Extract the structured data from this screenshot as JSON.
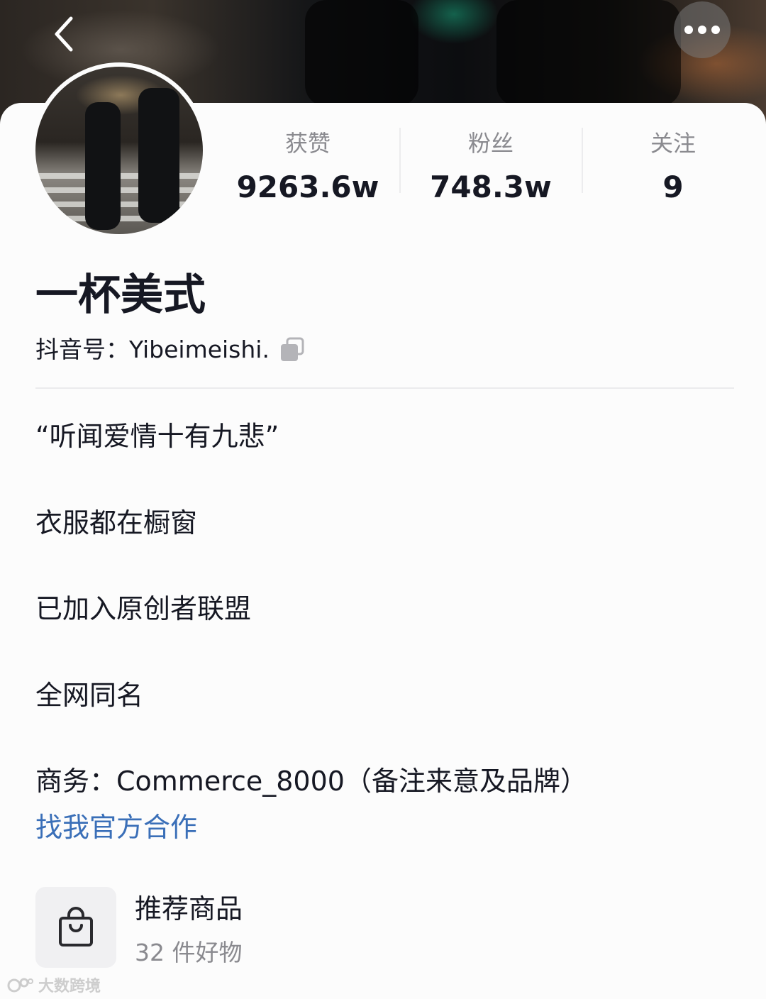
{
  "header": {
    "back_icon": "chevron-left-icon",
    "more_icon": "more-dots-icon"
  },
  "stats": [
    {
      "label": "获赞",
      "value": "9263.6w"
    },
    {
      "label": "粉丝",
      "value": "748.3w"
    },
    {
      "label": "关注",
      "value": "9"
    }
  ],
  "profile": {
    "name": "一杯美式",
    "douyin_id": "抖音号：Yibeimeishi.",
    "copy_icon": "copy-icon"
  },
  "bio": [
    "“听闻爱情十有九悲”",
    "衣服都在橱窗",
    "已加入原创者联盟",
    "全网同名",
    "商务：Commerce_8000（备注来意及品牌）"
  ],
  "link_text": "找我官方合作",
  "recommend": {
    "icon": "shopping-bag-icon",
    "title": "推荐商品",
    "subtitle": "32 件好物"
  },
  "watermark": "大数跨境",
  "colors": {
    "link": "#3a6fb8",
    "text": "#161823",
    "muted": "#8a8a8f"
  }
}
